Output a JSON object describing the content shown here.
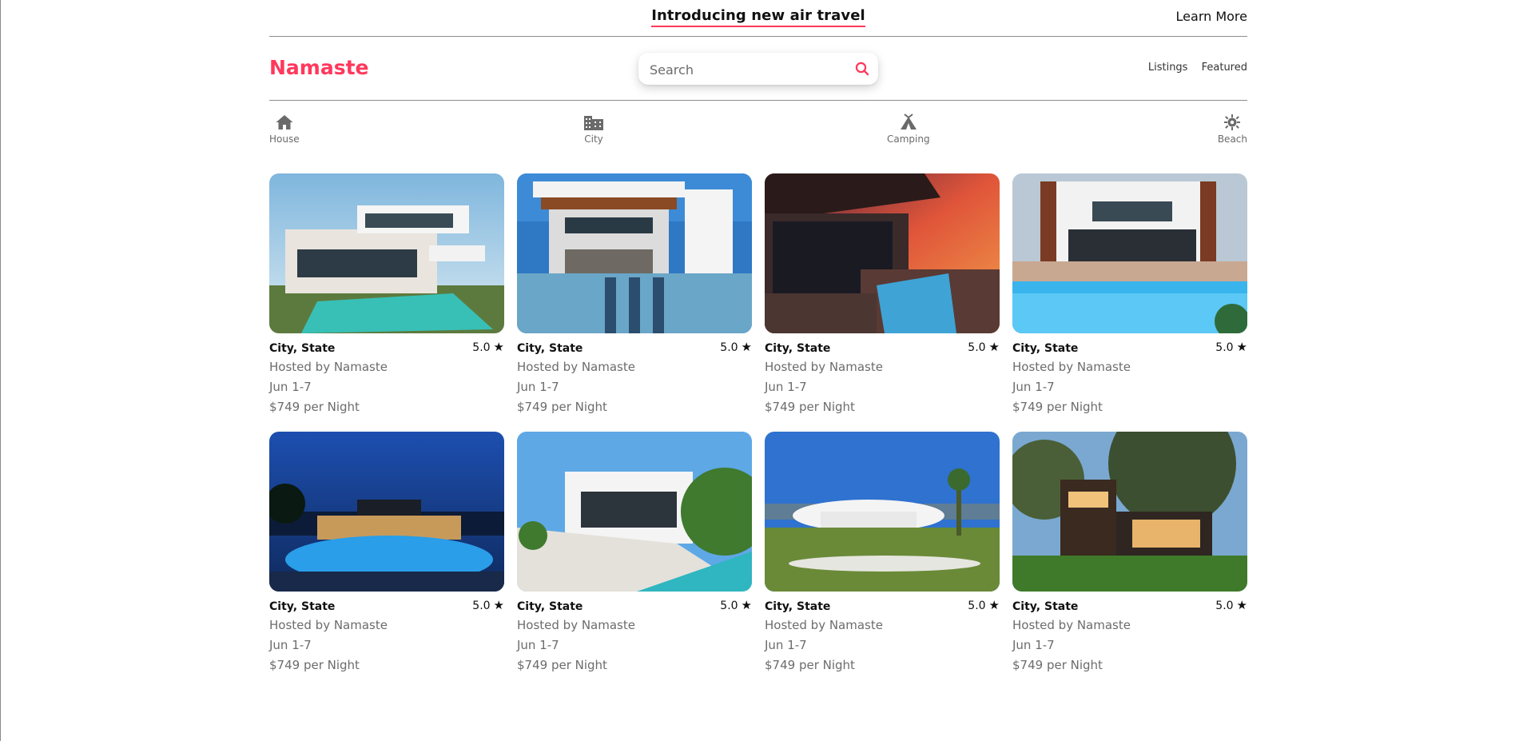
{
  "banner": {
    "title": "Introducing new air travel",
    "learn_more": "Learn More"
  },
  "header": {
    "logo": "Namaste",
    "search_placeholder": "Search",
    "nav": [
      "Listings",
      "Featured"
    ]
  },
  "categories": [
    {
      "label": "House",
      "icon": "house-icon"
    },
    {
      "label": "City",
      "icon": "city-icon"
    },
    {
      "label": "Camping",
      "icon": "camping-icon"
    },
    {
      "label": "Beach",
      "icon": "beach-icon"
    }
  ],
  "colors": {
    "accent": "#ff385c",
    "muted_text": "#6c6c6c"
  },
  "listings": [
    {
      "location": "City, State",
      "rating": "5.0",
      "host": "Hosted by Namaste",
      "dates": "Jun 1-7",
      "price": "$749 per Night"
    },
    {
      "location": "City, State",
      "rating": "5.0",
      "host": "Hosted by Namaste",
      "dates": "Jun 1-7",
      "price": "$749 per Night"
    },
    {
      "location": "City, State",
      "rating": "5.0",
      "host": "Hosted by Namaste",
      "dates": "Jun 1-7",
      "price": "$749 per Night"
    },
    {
      "location": "City, State",
      "rating": "5.0",
      "host": "Hosted by Namaste",
      "dates": "Jun 1-7",
      "price": "$749 per Night"
    },
    {
      "location": "City, State",
      "rating": "5.0",
      "host": "Hosted by Namaste",
      "dates": "Jun 1-7",
      "price": "$749 per Night"
    },
    {
      "location": "City, State",
      "rating": "5.0",
      "host": "Hosted by Namaste",
      "dates": "Jun 1-7",
      "price": "$749 per Night"
    },
    {
      "location": "City, State",
      "rating": "5.0",
      "host": "Hosted by Namaste",
      "dates": "Jun 1-7",
      "price": "$749 per Night"
    },
    {
      "location": "City, State",
      "rating": "5.0",
      "host": "Hosted by Namaste",
      "dates": "Jun 1-7",
      "price": "$749 per Night"
    }
  ]
}
